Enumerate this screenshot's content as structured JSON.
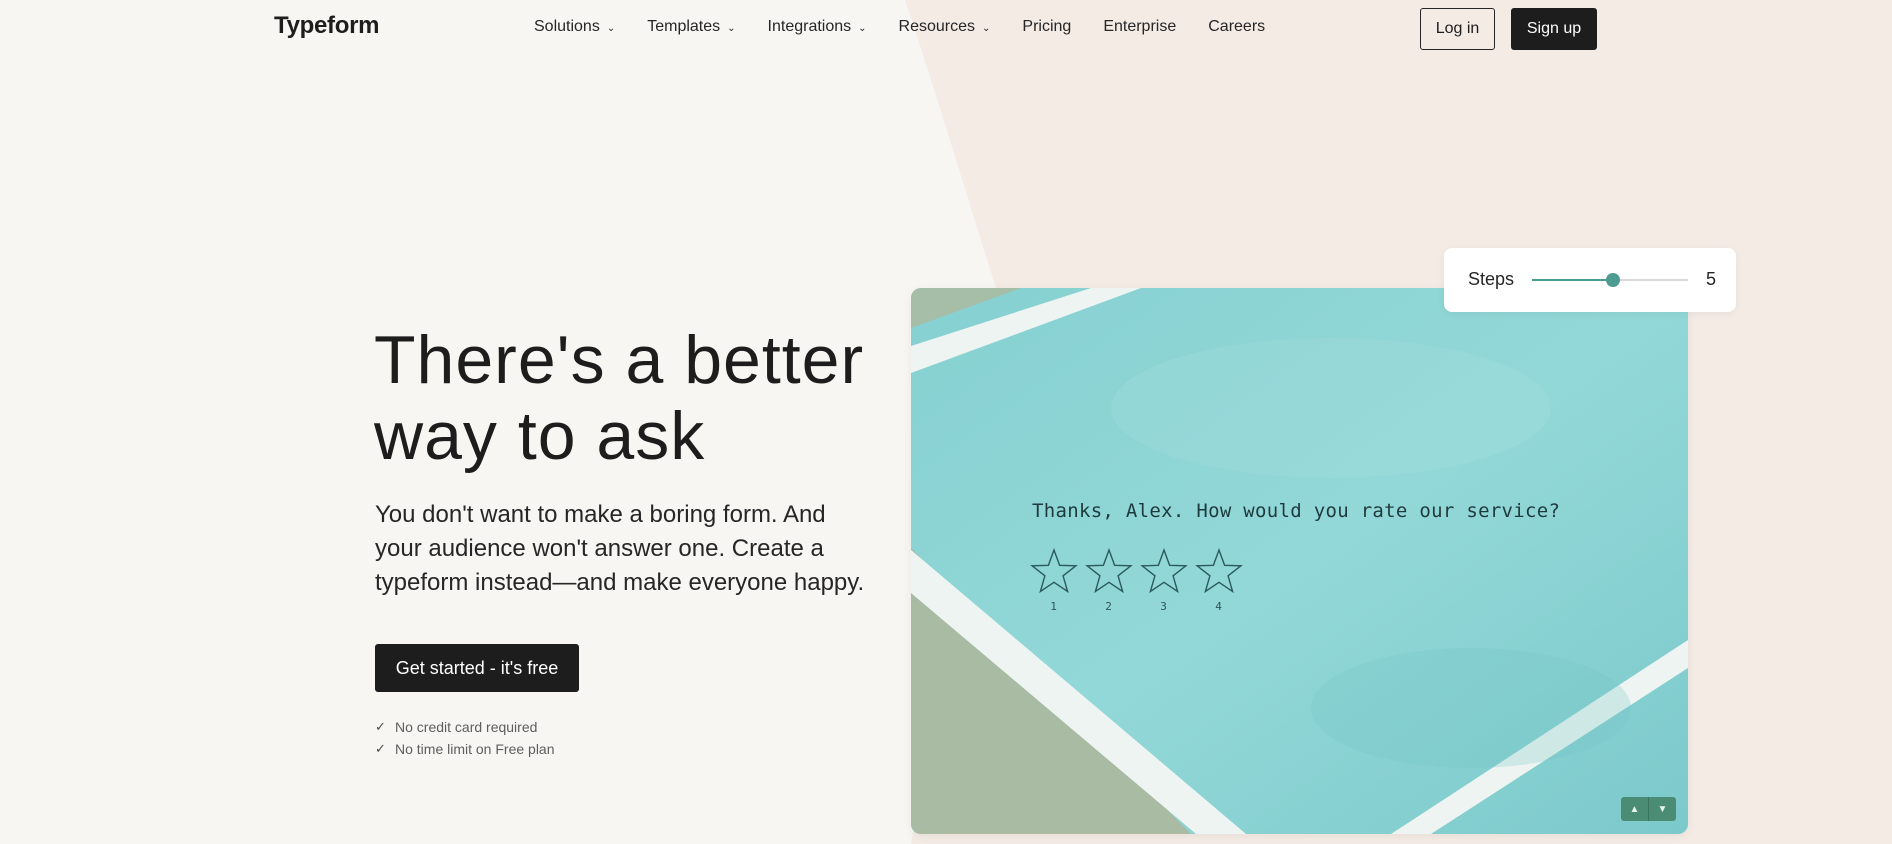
{
  "nav": {
    "logo": "Typeform",
    "menu": [
      {
        "label": "Solutions",
        "dropdown": true
      },
      {
        "label": "Templates",
        "dropdown": true
      },
      {
        "label": "Integrations",
        "dropdown": true
      },
      {
        "label": "Resources",
        "dropdown": true
      },
      {
        "label": "Pricing",
        "dropdown": false
      },
      {
        "label": "Enterprise",
        "dropdown": false
      },
      {
        "label": "Careers",
        "dropdown": false
      }
    ],
    "login_label": "Log in",
    "signup_label": "Sign up"
  },
  "hero": {
    "title_line1": "There's a better",
    "title_line2": "way to ask",
    "subtitle": "You don't want to make a boring form. And your audience won't answer one. Create a typeform instead—and make everyone happy.",
    "cta_label": "Get started - it's free",
    "checks": [
      "No credit card required",
      "No time limit on Free plan"
    ]
  },
  "preview": {
    "question": "Thanks, Alex. How would you rate our service?",
    "stars": [
      "1",
      "2",
      "3",
      "4"
    ],
    "up_icon": "chevron-up-icon",
    "down_icon": "chevron-down-icon"
  },
  "steps": {
    "label": "Steps",
    "value": "5",
    "slider_fraction": 0.52
  },
  "colors": {
    "background": "#f8f6f2",
    "accent_shape": "#f3ebe4",
    "dark": "#1d1d1d",
    "teal": "#8fd4d4",
    "slider": "#4d9c92"
  }
}
